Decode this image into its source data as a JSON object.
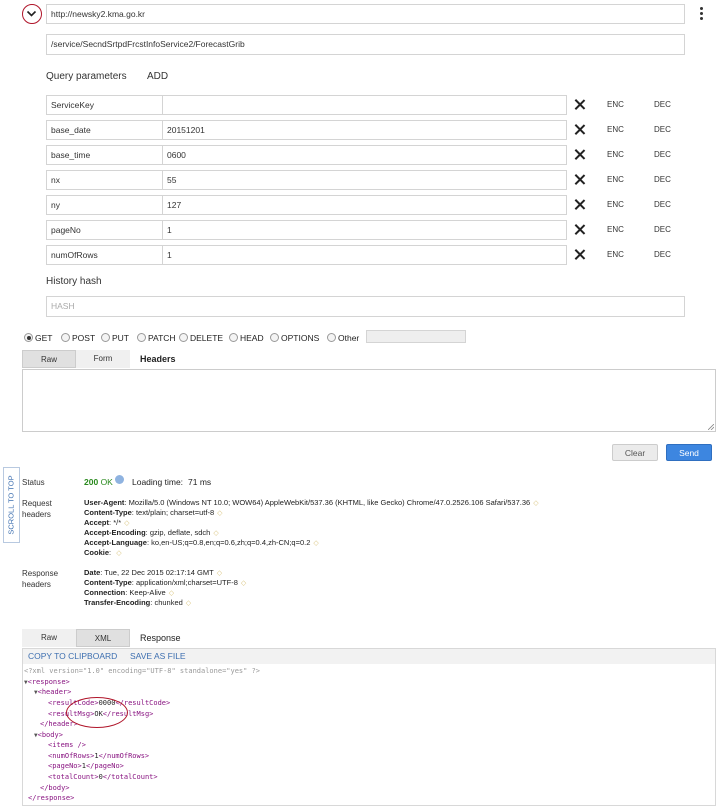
{
  "request": {
    "host": "http://newsky2.kma.go.kr",
    "path": "/service/SecndSrtpdFrcstInfoService2/ForecastGrib"
  },
  "query": {
    "title": "Query parameters",
    "add_label": "ADD",
    "enc_label": "ENC",
    "dec_label": "DEC",
    "params": [
      {
        "key": "ServiceKey",
        "value": ""
      },
      {
        "key": "base_date",
        "value": "20151201"
      },
      {
        "key": "base_time",
        "value": "0600"
      },
      {
        "key": "nx",
        "value": "55"
      },
      {
        "key": "ny",
        "value": "127"
      },
      {
        "key": "pageNo",
        "value": "1"
      },
      {
        "key": "numOfRows",
        "value": "1"
      }
    ]
  },
  "history": {
    "title": "History hash",
    "placeholder": "HASH"
  },
  "methods": {
    "options": [
      "GET",
      "POST",
      "PUT",
      "PATCH",
      "DELETE",
      "HEAD",
      "OPTIONS",
      "Other"
    ],
    "selected": "GET"
  },
  "body_tabs": {
    "raw": "Raw",
    "form": "Form",
    "headers_label": "Headers"
  },
  "buttons": {
    "clear": "Clear",
    "send": "Send",
    "scroll_to_top": "SCROLL TO TOP"
  },
  "status": {
    "label": "Status",
    "code": "200",
    "text": "OK",
    "loading_label": "Loading time:",
    "loading_value": "71 ms"
  },
  "request_headers": {
    "label_line1": "Request",
    "label_line2": "headers",
    "items": [
      {
        "name": "User-Agent",
        "value": "Mozilla/5.0 (Windows NT 10.0; WOW64) AppleWebKit/537.36 (KHTML, like Gecko) Chrome/47.0.2526.106 Safari/537.36"
      },
      {
        "name": "Content-Type",
        "value": "text/plain; charset=utf-8"
      },
      {
        "name": "Accept",
        "value": "*/*"
      },
      {
        "name": "Accept-Encoding",
        "value": "gzip, deflate, sdch"
      },
      {
        "name": "Accept-Language",
        "value": "ko,en-US;q=0.8,en;q=0.6,zh;q=0.4,zh-CN;q=0.2"
      },
      {
        "name": "Cookie",
        "value": ""
      }
    ]
  },
  "response_headers": {
    "label_line1": "Response",
    "label_line2": "headers",
    "items": [
      {
        "name": "Date",
        "value": "Tue, 22 Dec 2015 02:17:14 GMT"
      },
      {
        "name": "Content-Type",
        "value": "application/xml;charset=UTF-8"
      },
      {
        "name": "Connection",
        "value": "Keep-Alive"
      },
      {
        "name": "Transfer-Encoding",
        "value": "chunked"
      }
    ]
  },
  "response_tabs": {
    "raw": "Raw",
    "xml": "XML",
    "response_label": "Response",
    "copy": "COPY TO CLIPBOARD",
    "save": "SAVE AS FILE"
  },
  "xml": {
    "declaration": "<?xml version=\"1.0\" encoding=\"UTF-8\" standalone=\"yes\" ?>",
    "result_code": "0000",
    "result_msg": "OK",
    "num_of_rows": "1",
    "page_no": "1",
    "total_count": "0"
  },
  "colors": {
    "send_button": "#3d86e0",
    "status_ok": "#2a8a1e",
    "annotation_circle": "#b0152a",
    "xml_tag": "#881280"
  }
}
